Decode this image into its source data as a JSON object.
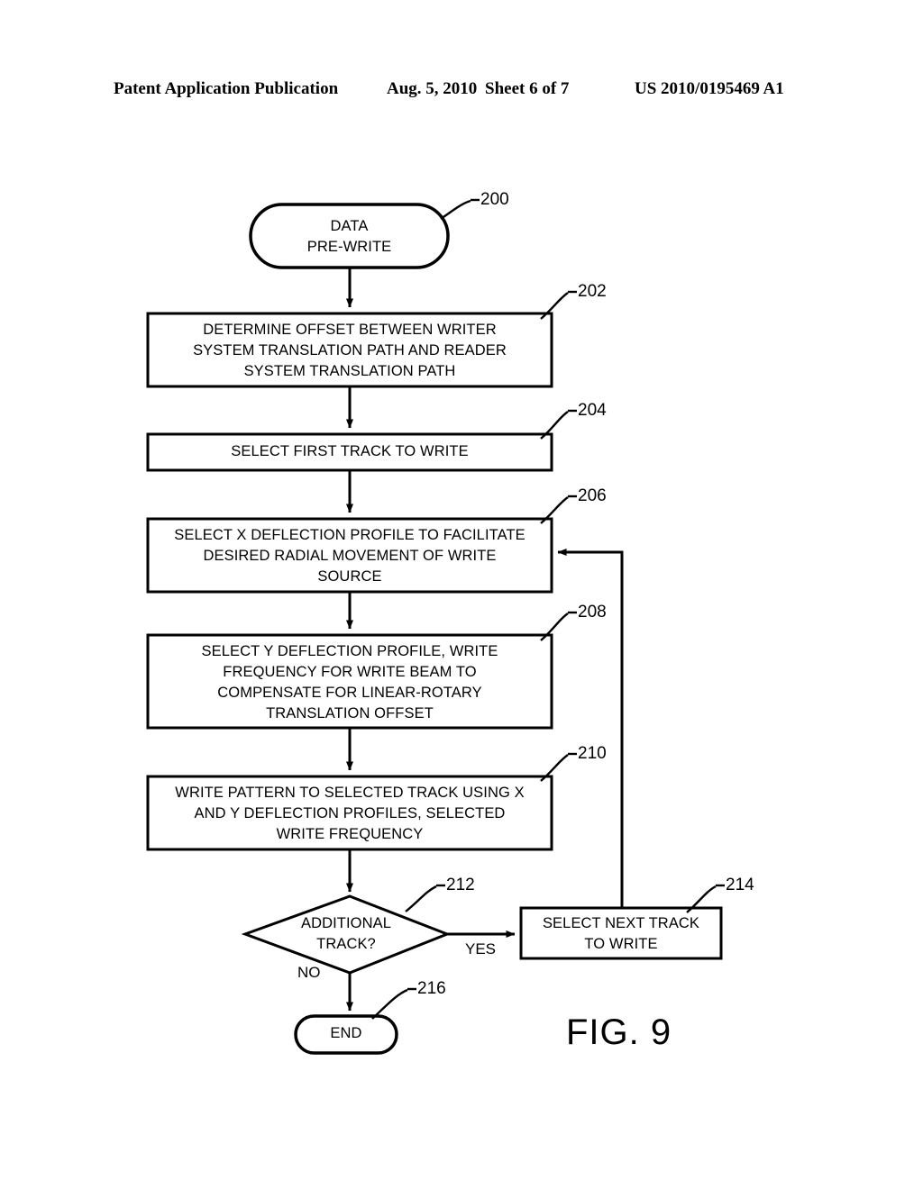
{
  "header": {
    "publication": "Patent Application Publication",
    "date": "Aug. 5, 2010",
    "sheet": "Sheet 6 of 7",
    "number": "US 2010/0195469 A1"
  },
  "figure": {
    "label": "FIG. 9",
    "caption_number": "9"
  },
  "flowchart": {
    "title": "DATA PRE-WRITE process",
    "nodes": [
      {
        "id": "start",
        "ref": "200",
        "shape": "stadium",
        "text": "DATA\nPRE-WRITE"
      },
      {
        "id": "determine-offset",
        "ref": "202",
        "shape": "rect",
        "text": "DETERMINE OFFSET BETWEEN WRITER\nSYSTEM TRANSLATION PATH AND READER\nSYSTEM TRANSLATION PATH"
      },
      {
        "id": "select-first-track",
        "ref": "204",
        "shape": "rect",
        "text": "SELECT FIRST TRACK TO WRITE"
      },
      {
        "id": "select-x-deflection",
        "ref": "206",
        "shape": "rect",
        "text": "SELECT X DEFLECTION PROFILE TO FACILITATE\nDESIRED RADIAL MOVEMENT OF WRITE\nSOURCE"
      },
      {
        "id": "select-y-deflection",
        "ref": "208",
        "shape": "rect",
        "text": "SELECT Y DEFLECTION PROFILE, WRITE\nFREQUENCY FOR WRITE BEAM TO\nCOMPENSATE FOR LINEAR-ROTARY\nTRANSLATION OFFSET"
      },
      {
        "id": "write-pattern",
        "ref": "210",
        "shape": "rect",
        "text": "WRITE PATTERN TO SELECTED TRACK USING X\nAND Y DEFLECTION PROFILES, SELECTED\nWRITE FREQUENCY"
      },
      {
        "id": "additional-track-decision",
        "ref": "212",
        "shape": "diamond",
        "text": "ADDITIONAL\nTRACK?"
      },
      {
        "id": "select-next-track",
        "ref": "214",
        "shape": "rect",
        "text": "SELECT NEXT TRACK\nTO WRITE"
      },
      {
        "id": "end",
        "ref": "216",
        "shape": "stadium",
        "text": "END"
      }
    ],
    "edge_labels": {
      "yes": "YES",
      "no": "NO"
    }
  },
  "colors": {
    "ink": "#000000",
    "paper": "#ffffff"
  }
}
